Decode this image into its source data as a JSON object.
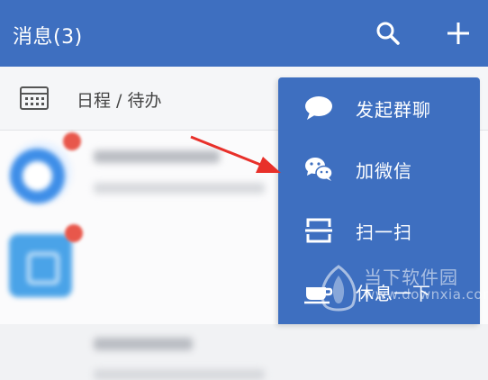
{
  "header": {
    "title": "消息(3)",
    "search_icon": "search-icon",
    "add_icon": "plus-icon",
    "background": "#3e6fc0"
  },
  "schedule": {
    "label": "日程 / 待办",
    "icon": "calendar-icon"
  },
  "menu": {
    "background": "#3e6fc0",
    "items": [
      {
        "label": "发起群聊",
        "icon": "chat-bubble-icon"
      },
      {
        "label": "加微信",
        "icon": "wechat-icon"
      },
      {
        "label": "扫一扫",
        "icon": "scan-icon"
      },
      {
        "label": "休息一下",
        "icon": "cup-icon"
      }
    ]
  },
  "watermark": {
    "name": "当下软件园",
    "url": "www.downxia.com"
  }
}
